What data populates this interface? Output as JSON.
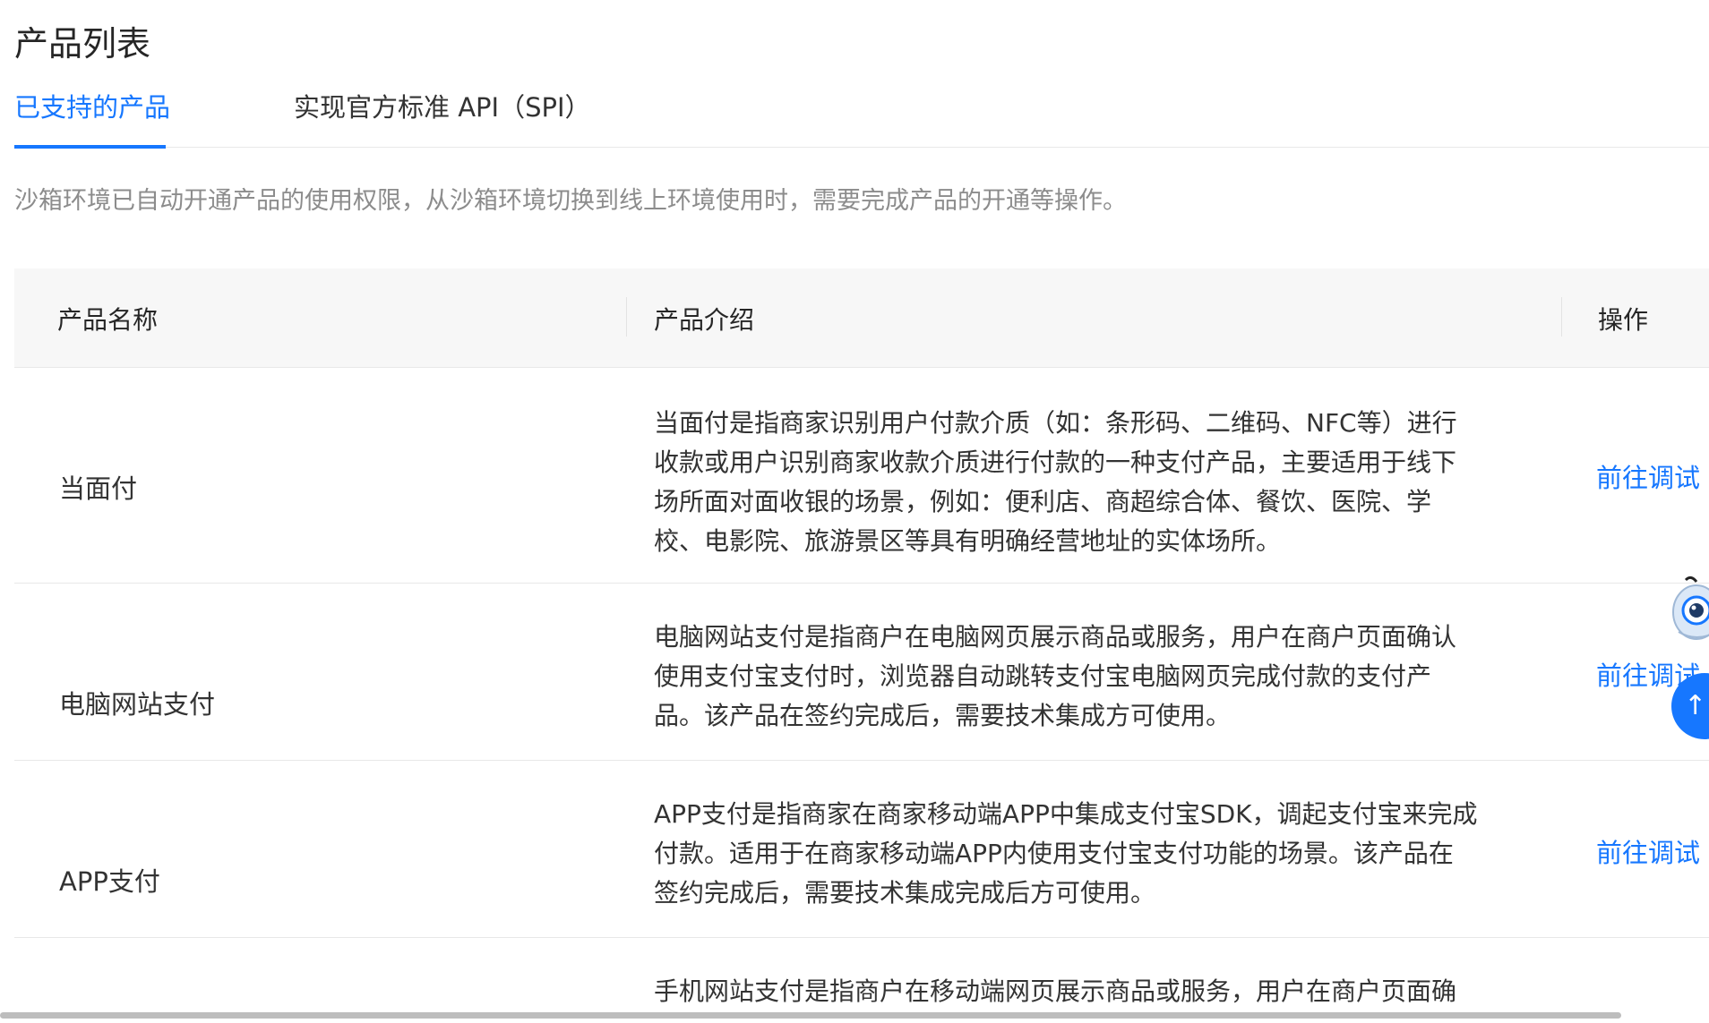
{
  "page": {
    "title": "产品列表",
    "notice": "沙箱环境已自动开通产品的使用权限，从沙箱环境切换到线上环境使用时，需要完成产品的开通等操作。"
  },
  "tabs": [
    {
      "label": "已支持的产品",
      "active": true
    },
    {
      "label": "实现官方标准 API（SPI）",
      "active": false
    }
  ],
  "table": {
    "columns": [
      "产品名称",
      "产品介绍",
      "操作"
    ],
    "rows": [
      {
        "name": "当面付",
        "description": "当面付是指商家识别用户付款介质（如：条形码、二维码、NFC等）进行收款或用户识别商家收款介质进行付款的一种支付产品，主要适用于线下场所面对面收银的场景，例如：便利店、商超综合体、餐饮、医院、学校、电影院、旅游景区等具有明确经营地址的实体场所。",
        "action": "前往调试"
      },
      {
        "name": "电脑网站支付",
        "description": "电脑网站支付是指商户在电脑网页展示商品或服务，用户在商户页面确认使用支付宝支付时，浏览器自动跳转支付宝电脑网页完成付款的支付产品。该产品在签约完成后，需要技术集成方可使用。",
        "action": "前往调试"
      },
      {
        "name": "APP支付",
        "description": "APP支付是指商家在商家移动端APP中集成支付宝SDK，调起支付宝来完成付款。适用于在商家移动端APP内使用支付宝支付功能的场景。该产品在签约完成后，需要技术集成完成后方可使用。",
        "action": "前往调试"
      },
      {
        "name": "",
        "description": "手机网站支付是指商户在移动端网页展示商品或服务，用户在商户页面确",
        "action": ""
      }
    ]
  },
  "floating": {
    "mascot_icon": "assistant-mascot-icon",
    "button_icon": "back-to-top-arrow-icon",
    "button_glyph": "↑"
  },
  "colors": {
    "accent": "#1677ff",
    "header_bg": "#f7f7f7",
    "muted_text": "#8c8c8c"
  }
}
